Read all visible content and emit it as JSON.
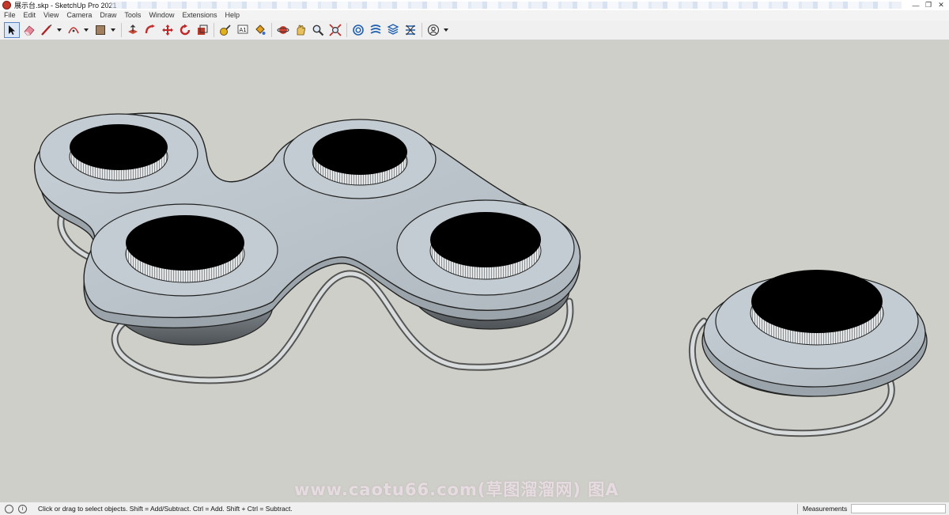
{
  "window": {
    "title": "展示台.skp - SketchUp Pro 2021",
    "controls": [
      "—",
      "❐",
      "✕"
    ]
  },
  "menu": {
    "items": [
      "File",
      "Edit",
      "View",
      "Camera",
      "Draw",
      "Tools",
      "Window",
      "Extensions",
      "Help"
    ]
  },
  "toolbar": {
    "tools": [
      "select-icon",
      "eraser-icon",
      "line-icon",
      "arc-icon",
      "rectangle-icon",
      "push-pull-icon",
      "move-icon",
      "rotate-icon",
      "scale-icon",
      "offset-icon",
      "tape-measure-icon",
      "text-icon",
      "paint-bucket-icon",
      "orbit-icon",
      "pan-icon",
      "zoom-icon",
      "zoom-extents-icon",
      "warehouse-icon",
      "extension-warehouse-icon",
      "layout-icon",
      "model-info-icon",
      "account-icon"
    ],
    "text_tool_glyph": "A1"
  },
  "viewport": {
    "background": "#cfcfc9",
    "watermark": "www.caotu66.com(草图溜溜网) 图A"
  },
  "statusbar": {
    "hint": "Click or drag to select objects. Shift = Add/Subtract. Ctrl = Add. Shift + Ctrl = Subtract.",
    "info_glyph": "i",
    "measurements_label": "Measurements",
    "measurements_value": ""
  }
}
